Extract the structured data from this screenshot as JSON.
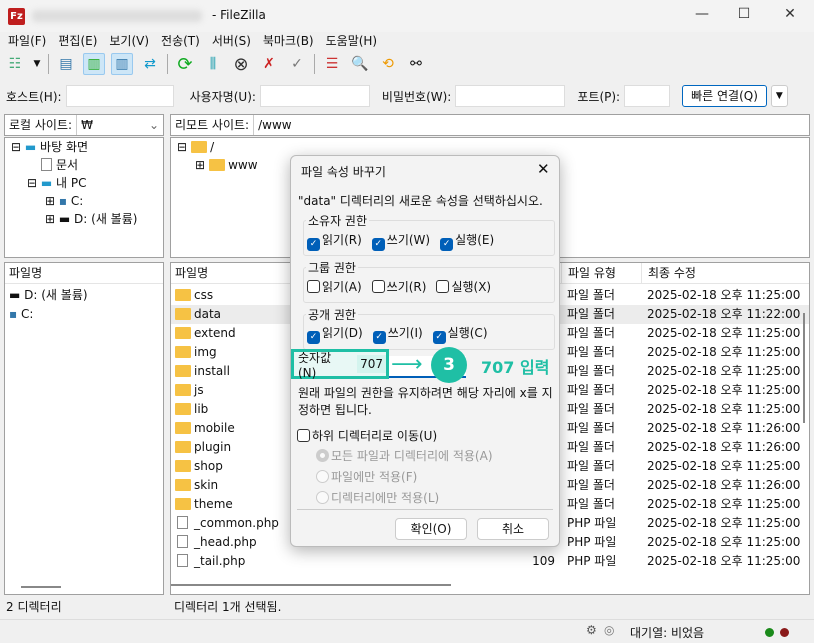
{
  "window": {
    "title": "- FileZilla",
    "minimize": "—",
    "maximize": "☐",
    "close": "✕"
  },
  "menu": [
    "파일(F)",
    "편집(E)",
    "보기(V)",
    "전송(T)",
    "서버(S)",
    "북마크(B)",
    "도움말(H)"
  ],
  "quickconnect": {
    "host_label": "호스트(H):",
    "host_value": "",
    "user_label": "사용자명(U):",
    "user_value": "",
    "pass_label": "비밀번호(W):",
    "pass_value": "",
    "port_label": "포트(P):",
    "port_value": "",
    "connect_label": "빠른 연결(Q)"
  },
  "local": {
    "site_label": "로컬 사이트:",
    "path": "₩",
    "tree": [
      "바탕 화면",
      "문서",
      "내 PC",
      "C:",
      "D: (새 볼륨)"
    ],
    "col_name": "파일명",
    "files": [
      "D: (새 볼륨)",
      "C:"
    ],
    "status": "2 디렉터리"
  },
  "remote": {
    "site_label": "리모트 사이트:",
    "path": "/www",
    "tree": [
      "/",
      "www"
    ],
    "cols": {
      "name": "파일명",
      "type": "파일 유형",
      "modified": "최종 수정"
    },
    "files": [
      {
        "name": "css",
        "size": "",
        "type": "파일 폴더",
        "modified": "2025-02-18 오후 11:25:00",
        "kind": "folder"
      },
      {
        "name": "data",
        "size": "",
        "type": "파일 폴더",
        "modified": "2025-02-18 오후 11:22:00",
        "kind": "folder"
      },
      {
        "name": "extend",
        "size": "",
        "type": "파일 폴더",
        "modified": "2025-02-18 오후 11:25:00",
        "kind": "folder"
      },
      {
        "name": "img",
        "size": "",
        "type": "파일 폴더",
        "modified": "2025-02-18 오후 11:25:00",
        "kind": "folder"
      },
      {
        "name": "install",
        "size": "",
        "type": "파일 폴더",
        "modified": "2025-02-18 오후 11:25:00",
        "kind": "folder"
      },
      {
        "name": "js",
        "size": "",
        "type": "파일 폴더",
        "modified": "2025-02-18 오후 11:25:00",
        "kind": "folder"
      },
      {
        "name": "lib",
        "size": "",
        "type": "파일 폴더",
        "modified": "2025-02-18 오후 11:25:00",
        "kind": "folder"
      },
      {
        "name": "mobile",
        "size": "",
        "type": "파일 폴더",
        "modified": "2025-02-18 오후 11:26:00",
        "kind": "folder"
      },
      {
        "name": "plugin",
        "size": "",
        "type": "파일 폴더",
        "modified": "2025-02-18 오후 11:26:00",
        "kind": "folder"
      },
      {
        "name": "shop",
        "size": "",
        "type": "파일 폴더",
        "modified": "2025-02-18 오후 11:25:00",
        "kind": "folder"
      },
      {
        "name": "skin",
        "size": "",
        "type": "파일 폴더",
        "modified": "2025-02-18 오후 11:26:00",
        "kind": "folder"
      },
      {
        "name": "theme",
        "size": "",
        "type": "파일 폴더",
        "modified": "2025-02-18 오후 11:25:00",
        "kind": "folder"
      },
      {
        "name": "_common.php",
        "size": "",
        "type": "PHP 파일",
        "modified": "2025-02-18 오후 11:25:00",
        "kind": "file"
      },
      {
        "name": "_head.php",
        "size": "",
        "type": "PHP 파일",
        "modified": "2025-02-18 오후 11:25:00",
        "kind": "file"
      },
      {
        "name": "_tail.php",
        "size": "109",
        "type": "PHP 파일",
        "modified": "2025-02-18 오후 11:25:00",
        "kind": "file"
      }
    ],
    "status": "디렉터리 1개 선택됨."
  },
  "dialog": {
    "title": "파일 속성 바꾸기",
    "close": "✕",
    "description": "\"data\" 디렉터리의 새로운 속성을 선택하십시오.",
    "owner": {
      "title": "소유자 권한",
      "read": "읽기(R)",
      "write": "쓰기(W)",
      "exec": "실행(E)",
      "checked": [
        true,
        true,
        true
      ]
    },
    "group": {
      "title": "그룹 권한",
      "read": "읽기(A)",
      "write": "쓰기(R)",
      "exec": "실행(X)",
      "checked": [
        false,
        false,
        false
      ]
    },
    "public": {
      "title": "공개 권한",
      "read": "읽기(D)",
      "write": "쓰기(I)",
      "exec": "실행(C)",
      "checked": [
        true,
        true,
        true
      ]
    },
    "numeric_label": "숫자값(N)",
    "numeric_value": "707",
    "hint": "원래 파일의 권한을 유지하려면 해당 자리에 x를 지정하면 됩니다.",
    "recurse": "하위 디렉터리로 이동(U)",
    "apply_all": "모든 파일과 디렉터리에 적용(A)",
    "apply_files": "파일에만 적용(F)",
    "apply_dirs": "디렉터리에만 적용(L)",
    "ok": "확인(O)",
    "cancel": "취소"
  },
  "annotation": {
    "step": "3",
    "text": "707 입력",
    "color": "#1fbfa5"
  },
  "statusbar": {
    "queue": "대기열: 비었음"
  }
}
